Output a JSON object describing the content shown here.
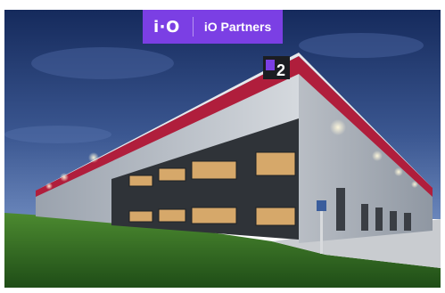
{
  "badge": {
    "mark": "i·O",
    "name": "iO Partners",
    "color": "#7b3fe4"
  },
  "building_sign": {
    "number": "2"
  },
  "colors": {
    "sky_top": "#1a2f63",
    "sky_bottom": "#5b78b0",
    "grass": "#2e6b22",
    "facade_stripe": "#b01e3c",
    "facade_dark": "#2f3338",
    "facade_light": "#c9cdd2"
  }
}
